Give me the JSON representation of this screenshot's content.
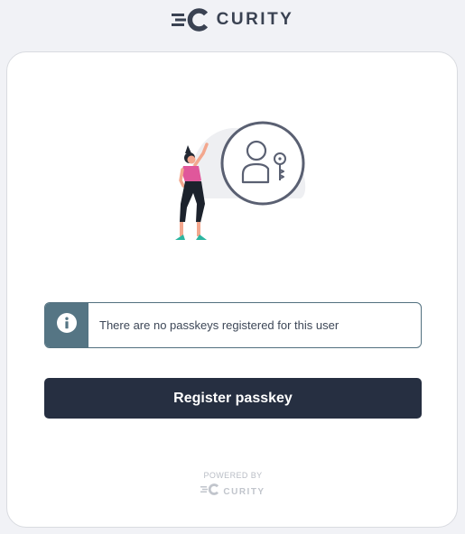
{
  "header": {
    "logo_text": "CURITY",
    "logo_icon": "curity-logo-icon"
  },
  "card": {
    "illustration_icon": "user-passkey-illustration",
    "alert": {
      "icon": "info-icon",
      "message": "There are no passkeys registered for this user"
    },
    "register_button_label": "Register passkey",
    "footer": {
      "powered_by_label": "POWERED BY",
      "logo_text": "CURITY"
    }
  },
  "colors": {
    "page_background": "#f1f2f6",
    "button_background": "#262f41",
    "alert_accent": "#557584",
    "text_dark": "#3d4757"
  }
}
